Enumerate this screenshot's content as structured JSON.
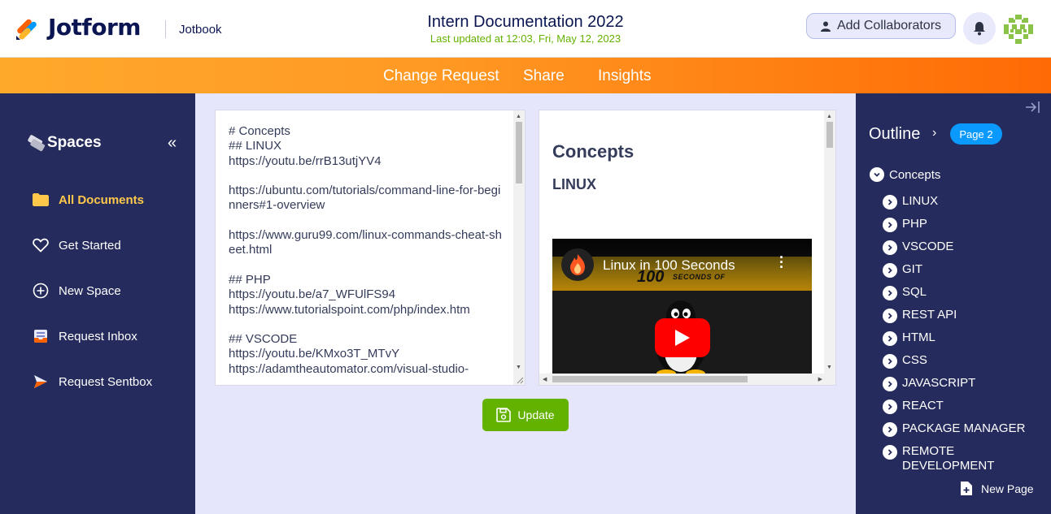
{
  "header": {
    "brand": "Jotform",
    "product": "Jotbook",
    "doc_title": "Intern Documentation 2022",
    "doc_updated": "Last updated at 12:03, Fri, May 12, 2023",
    "collab_label": "Add Collaborators",
    "icons": [
      "jotform-logo-icon",
      "user-icon",
      "bell-icon",
      "avatar"
    ]
  },
  "topnav": {
    "change_request": "Change Request",
    "share": "Share",
    "insights": "Insights"
  },
  "sidebar": {
    "title": "Spaces",
    "items": [
      {
        "label": "All Documents",
        "icon": "folder-icon",
        "active": true
      },
      {
        "label": "Get Started",
        "icon": "heart-icon"
      },
      {
        "label": "New Space",
        "icon": "plus-circle-icon"
      },
      {
        "label": "Request Inbox",
        "icon": "inbox-icon"
      },
      {
        "label": "Request Sentbox",
        "icon": "send-icon"
      }
    ]
  },
  "editor": {
    "content": "# Concepts\n## LINUX\nhttps://youtu.be/rrB13utjYV4\n\nhttps://ubuntu.com/tutorials/command-line-for-beginners#1-overview\n\nhttps://www.guru99.com/linux-commands-cheat-sheet.html\n\n## PHP\nhttps://youtu.be/a7_WFUlFS94\nhttps://www.tutorialspoint.com/php/index.htm\n\n## VSCODE\nhttps://youtu.be/KMxo3T_MTvY\nhttps://adamtheautomator.com/visual-studio-"
  },
  "preview": {
    "h1": "Concepts",
    "h2": "LINUX",
    "video": {
      "title": "Linux in 100 Seconds",
      "thumb_big": "100",
      "thumb_small": "SECONDS OF"
    }
  },
  "update_label": "Update",
  "outline": {
    "title": "Outline",
    "page_badge": "Page 2",
    "root": "Concepts",
    "items": [
      "LINUX",
      "PHP",
      "VSCODE",
      "GIT",
      "SQL",
      "REST API",
      "HTML",
      "CSS",
      "JAVASCRIPT",
      "REACT",
      "PACKAGE MANAGER",
      "REMOTE DEVELOPMENT"
    ],
    "new_page": "New Page"
  },
  "colors": {
    "navy": "#252b5c",
    "orange": "#ff7f12",
    "green": "#64b200",
    "blue_badge": "#0a99ff",
    "active_nav": "#ffc84a"
  }
}
